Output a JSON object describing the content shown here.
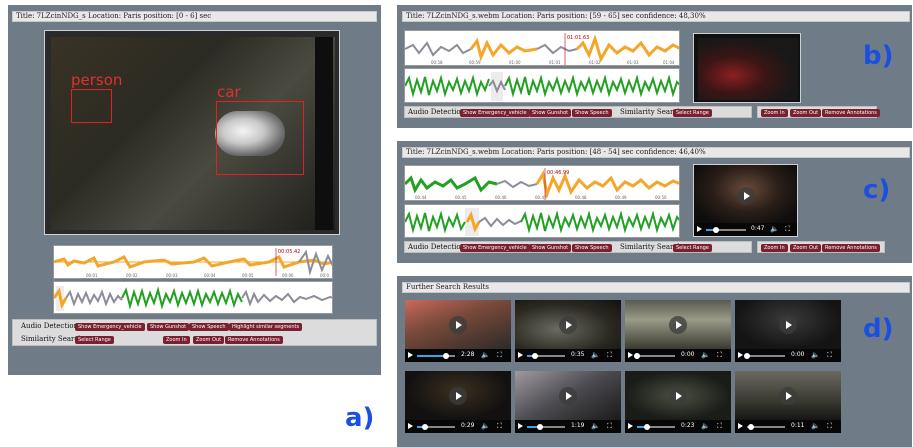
{
  "colors": {
    "panel": "#6f7c88",
    "button": "#7a2030",
    "label_blue": "#1a4fe0",
    "wave_orange": "#f4a62a",
    "wave_gray": "#8c8c98",
    "wave_green": "#22a022"
  },
  "panel_a": {
    "label": "a)",
    "title": "Title: 7LZcinNDG_s Location: Paris position: [0 - 6] sec",
    "detections": [
      {
        "label": "person"
      },
      {
        "label": "car"
      }
    ],
    "wave_marker": "00:05.42",
    "wave_ticks": [
      "00:01",
      "00:02",
      "00:03",
      "00:04",
      "00:05",
      "00:06",
      "00:0"
    ],
    "toolbar": {
      "audio_label": "Audio Detections",
      "buttons": [
        "Show Emergency_vehicle",
        "Show Gunshot",
        "Show Speech",
        "Highlight similar segments"
      ],
      "similarity_label": "Similarity Search",
      "select_range": "Select Range",
      "zoom_in": "Zoom In",
      "zoom_out": "Zoom Out",
      "remove": "Remove Annotations"
    }
  },
  "panel_b": {
    "label": "b)",
    "title": "Title: 7LZcinNDG_s.webm Location: Paris position: [59 - 65] sec confidence: 48,30%",
    "wave_marker": "01:01.63",
    "wave_ticks": [
      "00:58",
      "00:59",
      "01:00",
      "01:01",
      "01:02",
      "01:03",
      "01:04"
    ],
    "toolbar": {
      "audio_label": "Audio Detections",
      "buttons": [
        "Show Emergency_vehicle",
        "Show Gunshot",
        "Show Speech"
      ],
      "similarity_label": "Similarity Search",
      "select_range": "Select Range",
      "zoom_in": "Zoom In",
      "zoom_out": "Zoom Out",
      "remove": "Remove Annotations"
    }
  },
  "panel_c": {
    "label": "c)",
    "title": "Title: 7LZcinNDG_s.webm Location: Paris position: [48 - 54] sec confidence: 46,40%",
    "wave_marker": "00:46.99",
    "wave_ticks": [
      "00:44",
      "00:45",
      "00:46",
      "00:47",
      "00:48",
      "00:49",
      "00:50"
    ],
    "video_time": "0:47",
    "video_progress": 0.25,
    "toolbar": {
      "audio_label": "Audio Detections",
      "buttons": [
        "Show Emergency_vehicle",
        "Show Gunshot",
        "Show Speech"
      ],
      "similarity_label": "Similarity Search",
      "select_range": "Select Range",
      "zoom_in": "Zoom In",
      "zoom_out": "Zoom Out",
      "remove": "Remove Annotations"
    }
  },
  "panel_d": {
    "label": "d)",
    "title": "Further Search Results",
    "videos": [
      {
        "time": "2:28",
        "progress": 0.75
      },
      {
        "time": "0:35",
        "progress": 0.2
      },
      {
        "time": "0:00",
        "progress": 0.0
      },
      {
        "time": "0:00",
        "progress": 0.0
      },
      {
        "time": "0:29",
        "progress": 0.2
      },
      {
        "time": "1:19",
        "progress": 0.35
      },
      {
        "time": "0:23",
        "progress": 0.25
      },
      {
        "time": "0:11",
        "progress": 0.1
      }
    ]
  }
}
